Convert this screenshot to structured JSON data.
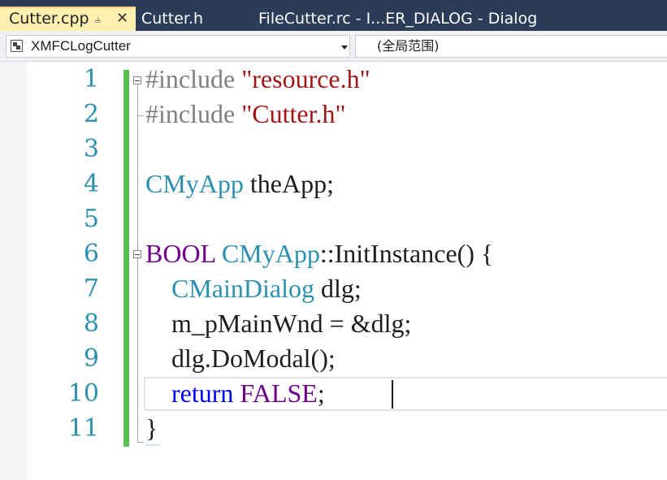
{
  "tabs": [
    {
      "label": "Cutter.cpp",
      "active": true
    },
    {
      "label": "Cutter.h",
      "active": false
    },
    {
      "label": "FileCutter.rc - I...ER_DIALOG - Dialog",
      "active": false
    }
  ],
  "tab_icons": {
    "pin": "pin-icon",
    "close": "close-icon"
  },
  "navbar": {
    "class_combo": "XMFCLogCutter",
    "scope_combo": "(全局范围)"
  },
  "editor": {
    "line_numbers": [
      "1",
      "2",
      "3",
      "4",
      "5",
      "6",
      "7",
      "8",
      "9",
      "10",
      "11"
    ],
    "lines": [
      [
        {
          "t": "#include ",
          "c": "pp"
        },
        {
          "t": "\"resource.h\"",
          "c": "st"
        }
      ],
      [
        {
          "t": "#include ",
          "c": "pp"
        },
        {
          "t": "\"Cutter.h\"",
          "c": "st"
        }
      ],
      [],
      [
        {
          "t": "CMyApp",
          "c": "ty"
        },
        {
          "t": " theApp;",
          "c": ""
        }
      ],
      [],
      [
        {
          "t": "BOOL",
          "c": "mc"
        },
        {
          "t": " ",
          "c": ""
        },
        {
          "t": "CMyApp",
          "c": "ty"
        },
        {
          "t": "::InitInstance() {",
          "c": ""
        }
      ],
      [
        {
          "t": "    ",
          "c": ""
        },
        {
          "t": "CMainDialog",
          "c": "ty"
        },
        {
          "t": " dlg;",
          "c": ""
        }
      ],
      [
        {
          "t": "    m_pMainWnd = &dlg;",
          "c": ""
        }
      ],
      [
        {
          "t": "    dlg.DoModal();",
          "c": ""
        }
      ],
      [
        {
          "t": "    ",
          "c": ""
        },
        {
          "t": "return",
          "c": "kw"
        },
        {
          "t": " ",
          "c": ""
        },
        {
          "t": "FALSE",
          "c": "mc"
        },
        {
          "t": ";",
          "c": ""
        }
      ],
      [
        {
          "t": "}",
          "c": ""
        }
      ]
    ],
    "current_line": 10
  },
  "colors": {
    "tabbar_bg": "#2b3c59",
    "active_tab_bg": "#fff0b0",
    "line_number": "#2b91af",
    "change_bar": "#58c152",
    "keyword": "#0000ff",
    "type": "#2b91af",
    "string": "#a31515",
    "preprocessor": "#808080",
    "macro": "#6f008a"
  }
}
